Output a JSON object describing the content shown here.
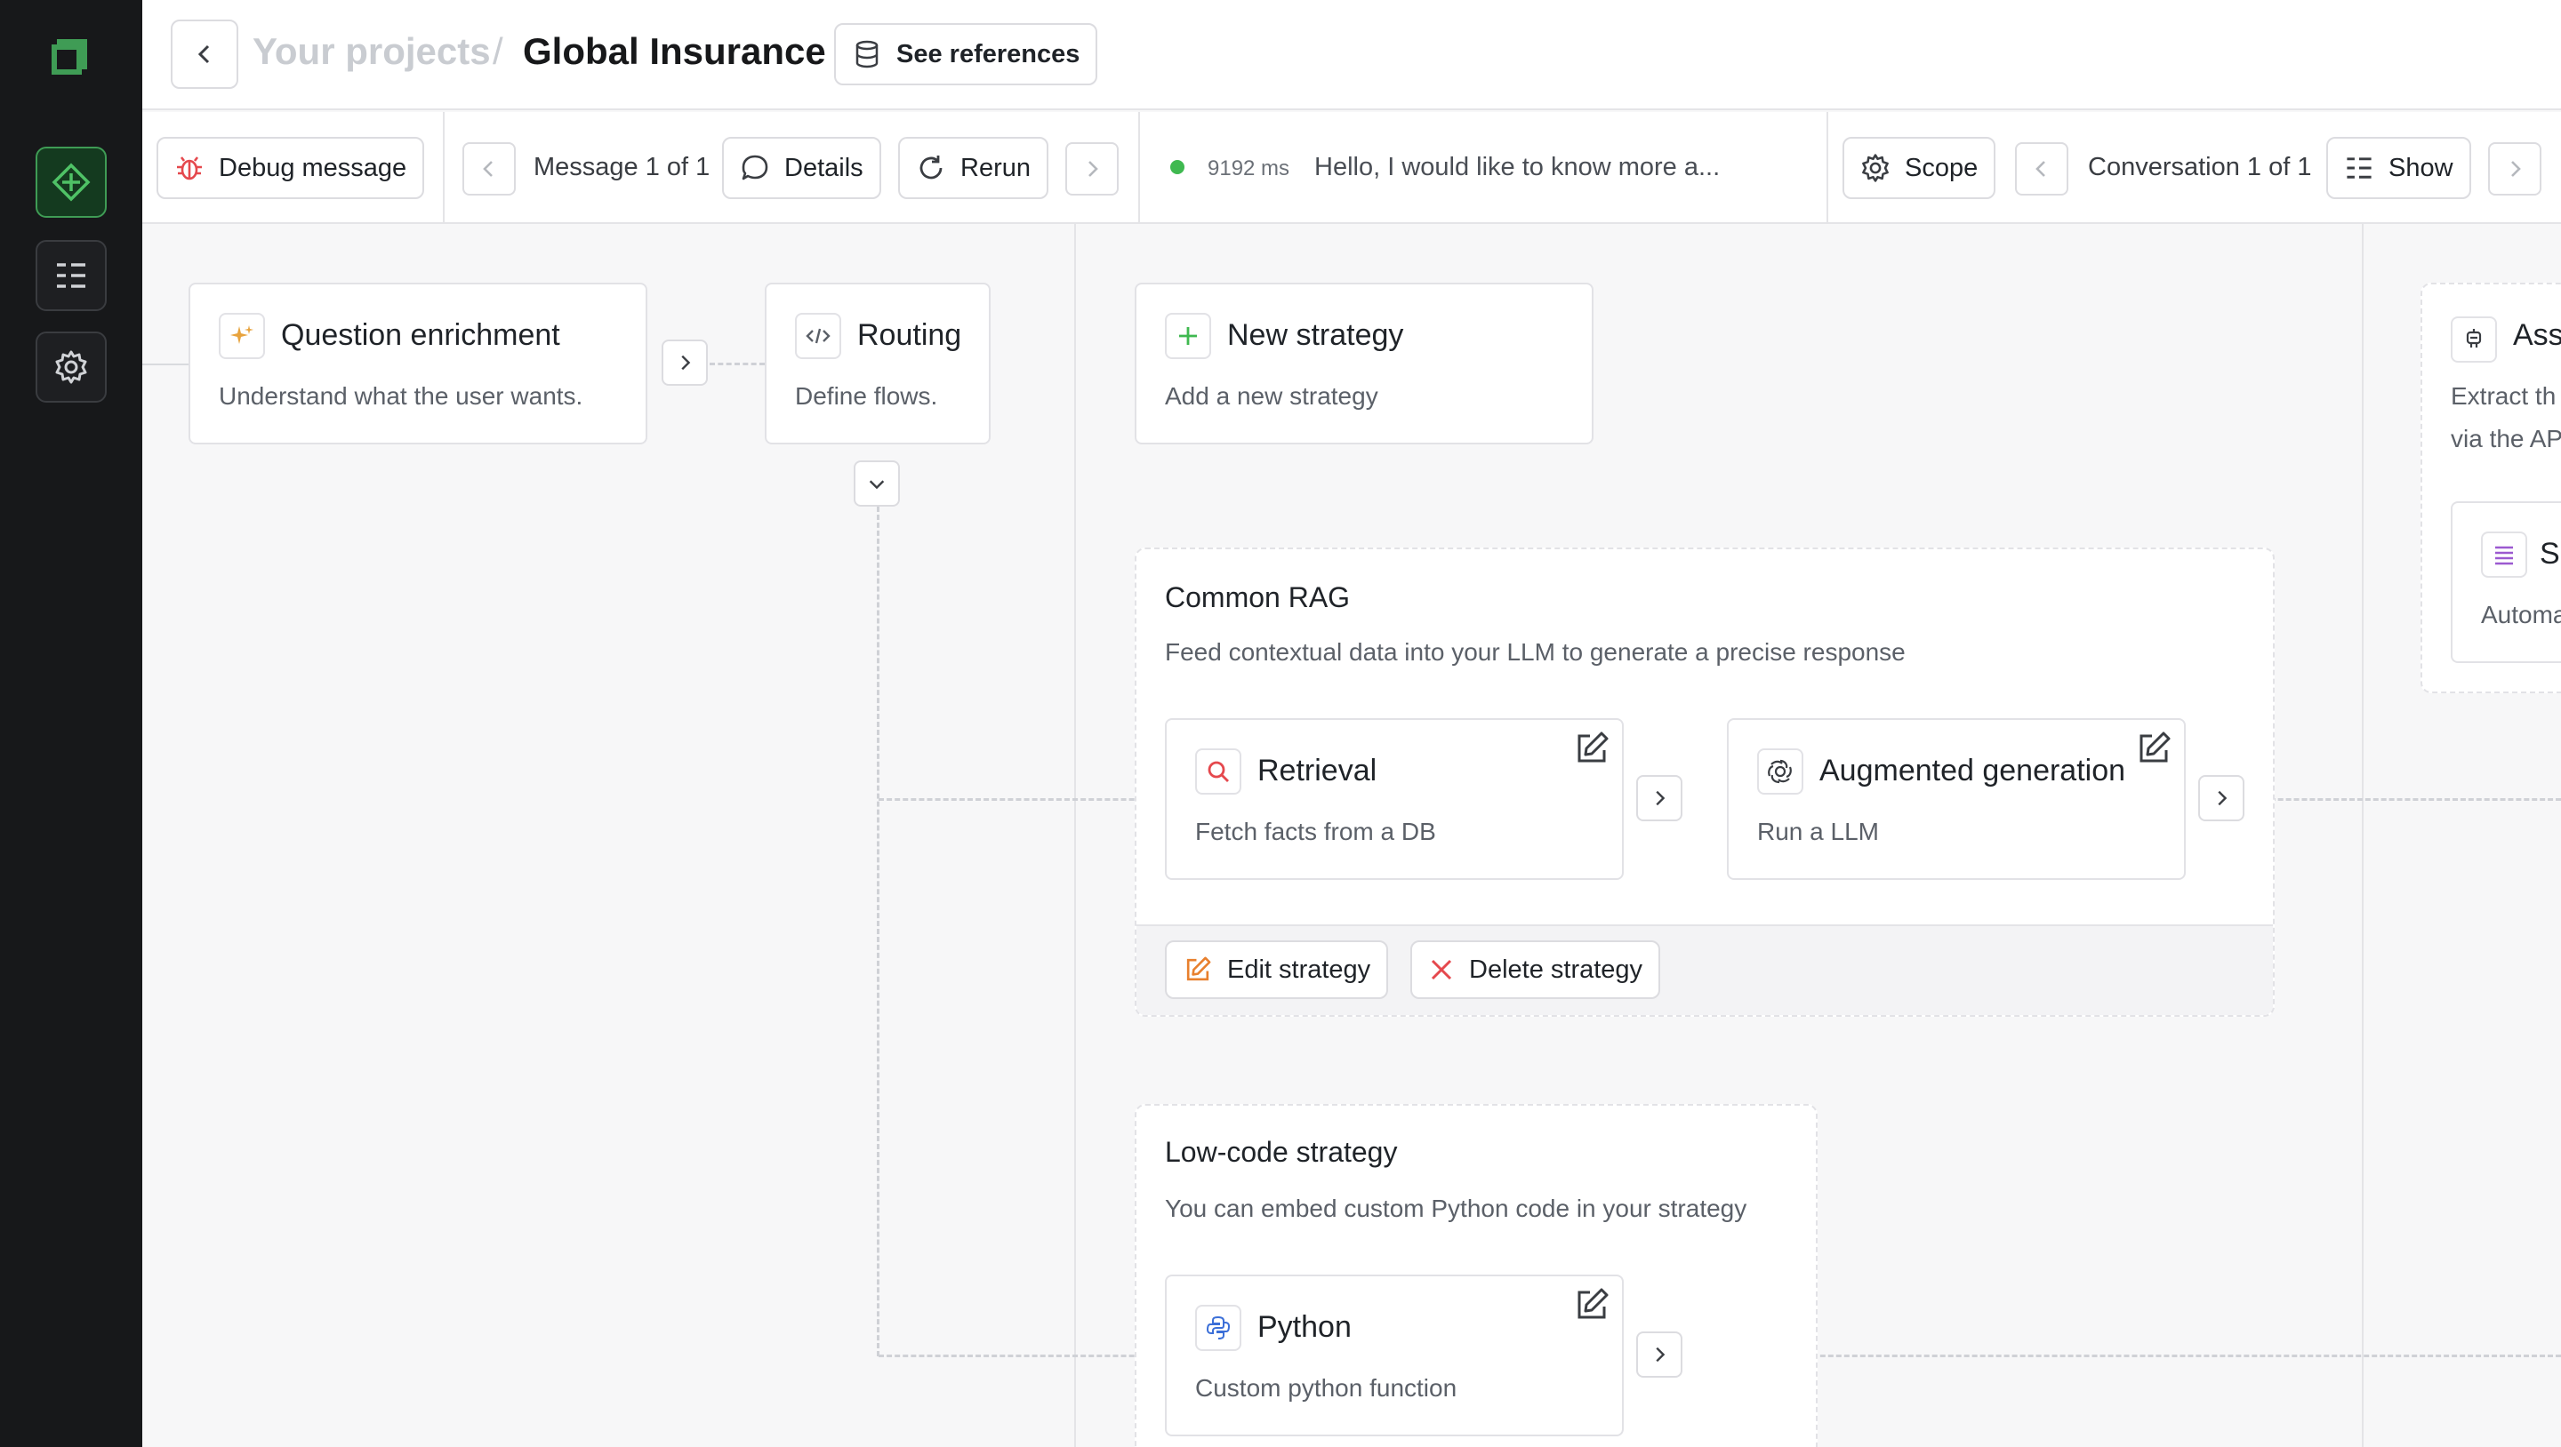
{
  "header": {
    "breadcrumb_parent": "Your projects",
    "breadcrumb_separator": "/",
    "project_title": "Global Insurance",
    "see_references_label": "See references"
  },
  "toolbar": {
    "debug_label": "Debug message",
    "message_counter": "Message 1 of 1",
    "details_label": "Details",
    "rerun_label": "Rerun",
    "latency": "9192 ms",
    "message_preview": "Hello, I would like to know more a...",
    "scope_label": "Scope",
    "conversation_counter": "Conversation 1 of 1",
    "show_label": "Show"
  },
  "pipeline": {
    "question_enrichment": {
      "title": "Question enrichment",
      "desc": "Understand what the user wants."
    },
    "routing": {
      "title": "Routing",
      "desc": "Define flows."
    },
    "new_strategy": {
      "title": "New strategy",
      "desc": "Add a new strategy"
    },
    "assistant": {
      "title": "Ass",
      "desc_line1": "Extract th",
      "desc_line2": "via the AP"
    },
    "sub_card": {
      "title": "S",
      "desc": "Automa"
    }
  },
  "strategies": {
    "common_rag": {
      "title": "Common RAG",
      "desc": "Feed contextual data into your LLM to generate a precise response",
      "retrieval": {
        "title": "Retrieval",
        "desc": "Fetch facts from a DB"
      },
      "augmented": {
        "title": "Augmented generation",
        "desc": "Run a LLM"
      },
      "edit_label": "Edit strategy",
      "delete_label": "Delete strategy"
    },
    "low_code": {
      "title": "Low-code strategy",
      "desc": "You can embed custom Python code in your strategy",
      "python": {
        "title": "Python",
        "desc": "Custom python function"
      }
    }
  },
  "colors": {
    "accent_green": "#3f9c55",
    "status_dot": "#3fb950",
    "debug_red": "#e5484d",
    "sparkle_orange": "#e8a33d",
    "edit_orange": "#e8802e",
    "python_blue": "#3b6fd8",
    "list_purple": "#9b59d0"
  }
}
